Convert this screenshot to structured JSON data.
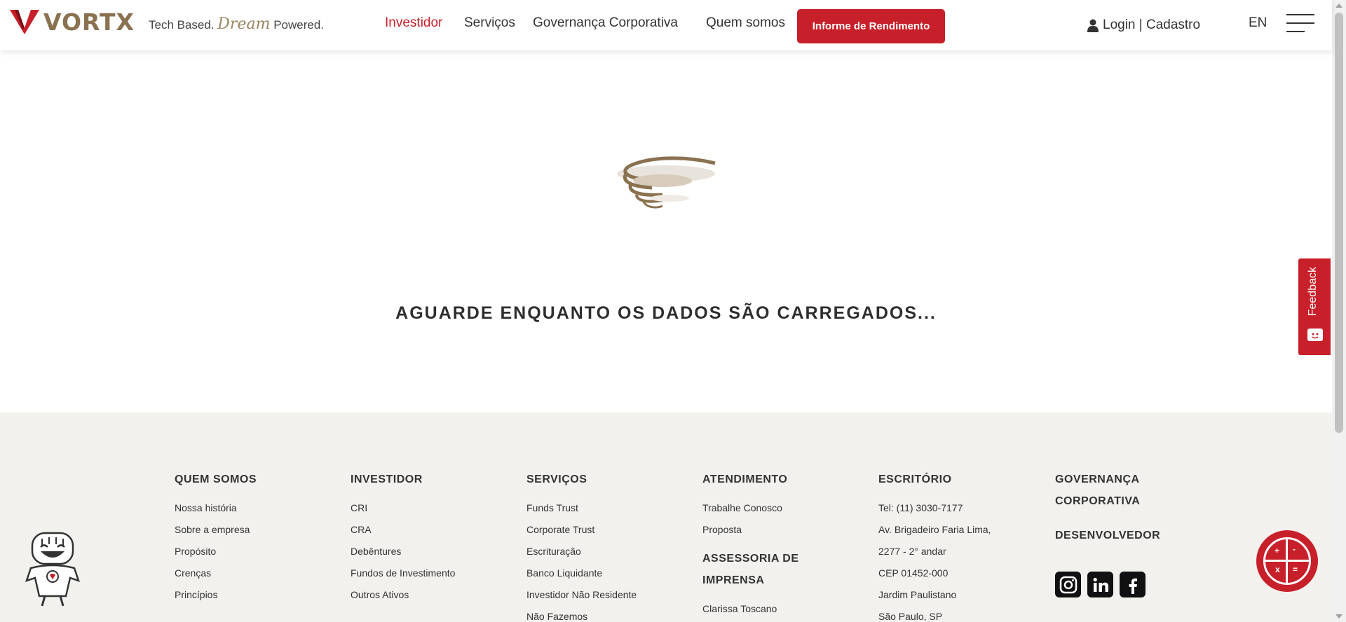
{
  "header": {
    "logo_text": "VORTX",
    "tagline_pre": "Tech Based.",
    "tagline_dream": "Dream",
    "tagline_post": "Powered.",
    "nav": [
      "Investidor",
      "Serviços",
      "Governança Corporativa",
      "Quem somos"
    ],
    "active_nav": "Investidor",
    "cta_label": "Informe de Rendimento",
    "login_label": "Login | Cadastro",
    "language": "EN",
    "menu_icon": "hamburger-icon"
  },
  "main": {
    "loading_message": "AGUARDE ENQUANTO OS DADOS SÃO CARREGADOS..."
  },
  "feedback": {
    "label": "Feedback",
    "icon": "chat-icon"
  },
  "footer": {
    "columns": [
      {
        "heading": "QUEM SOMOS",
        "links": [
          "Nossa história",
          "Sobre a empresa",
          "Propósito",
          "Crenças",
          "Princípios"
        ]
      },
      {
        "heading": "INVESTIDOR",
        "links": [
          "CRI",
          "CRA",
          "Debêntures",
          "Fundos de Investimento",
          "Outros Ativos"
        ]
      },
      {
        "heading": "SERVIÇOS",
        "links": [
          "Funds Trust",
          "Corporate Trust",
          "Escrituração",
          "Banco Liquidante",
          "Investidor Não Residente",
          "Não Fazemos"
        ]
      },
      {
        "heading": "ATENDIMENTO",
        "links": [
          "Trabalhe Conosco",
          "Proposta"
        ]
      },
      {
        "heading": "ESCRITÓRIO",
        "links": [
          "Tel: (11) 3030-7177",
          "Av. Brigadeiro Faria Lima,",
          "2277 - 2° andar",
          "CEP 01452-000",
          "Jardim Paulistano",
          "São Paulo, SP"
        ]
      }
    ],
    "press": {
      "heading_line1": "ASSESSORIA DE",
      "heading_line2": "IMPRENSA",
      "links": [
        "Clarissa Toscano"
      ]
    },
    "gov": {
      "heading_line1": "GOVERNANÇA",
      "heading_line2": "CORPORATIVA",
      "dev": "DESENVOLVEDOR"
    },
    "social": [
      "instagram-icon",
      "linkedin-icon",
      "facebook-icon"
    ],
    "calculator": {
      "symbols": [
        "+",
        "-",
        "x",
        "="
      ]
    }
  },
  "colors": {
    "brand_red": "#c8202a",
    "brand_gold": "#8a7150",
    "footer_bg": "#f2f1ee"
  }
}
